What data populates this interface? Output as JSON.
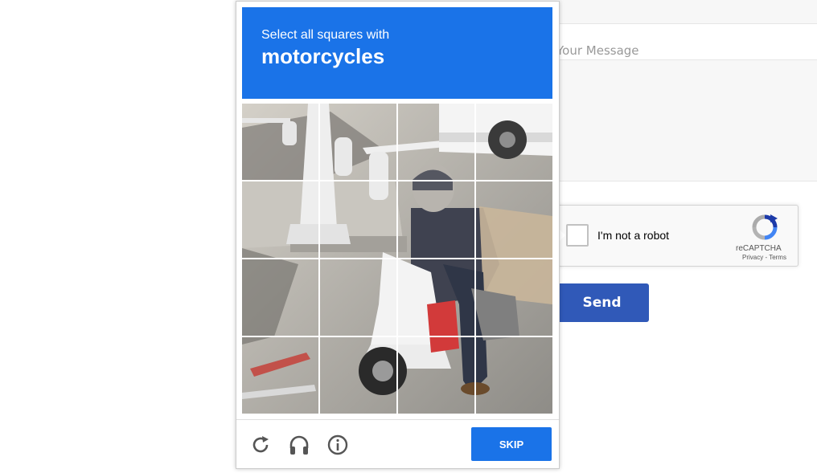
{
  "form": {
    "message_label": "Your Message",
    "send_label": "Send"
  },
  "recaptcha_widget": {
    "checkbox_label": "I'm not a robot",
    "brand": "reCAPTCHA",
    "links": "Privacy - Terms"
  },
  "challenge": {
    "instruction": "Select all squares with",
    "target": "motorcycles",
    "grid": {
      "rows": 4,
      "cols": 4
    },
    "footer_icons": [
      "reload-icon",
      "audio-headphones-icon",
      "info-icon"
    ],
    "skip_label": "SKIP"
  },
  "colors": {
    "challenge_blue": "#1a73e8",
    "send_blue": "#3059b8"
  }
}
